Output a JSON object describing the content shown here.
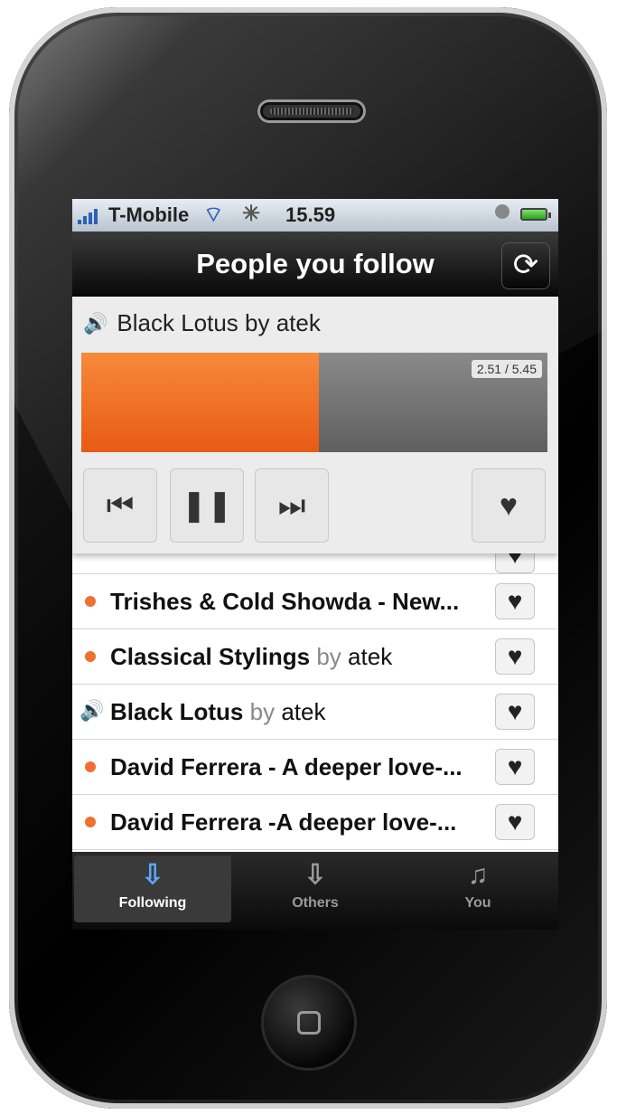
{
  "status_bar": {
    "carrier": "T-Mobile",
    "time": "15.59"
  },
  "nav": {
    "title": "People you follow",
    "refresh_icon": "refresh-icon"
  },
  "player": {
    "now_playing": "Black Lotus by atek",
    "elapsed": "2.51",
    "total": "5.45",
    "time_label": "2.51 / 5.45",
    "progress": 0.51,
    "colors": {
      "played": "#f07030",
      "unplayed": "#6f6f6f"
    },
    "controls": {
      "prev": "⏮",
      "pause": "❚❚",
      "next": "⏭",
      "favorite": "♥"
    }
  },
  "tracks": [
    {
      "title": "Trishes & Cold Showda - New...",
      "by": "",
      "artist": "",
      "playing": false
    },
    {
      "title": "Classical Stylings",
      "by": "by",
      "artist": "atek",
      "playing": false
    },
    {
      "title": "Black Lotus",
      "by": "by",
      "artist": "atek",
      "playing": true
    },
    {
      "title": "David Ferrera - A deeper love-...",
      "by": "",
      "artist": "",
      "playing": false
    },
    {
      "title": "David Ferrera -A deeper love-...",
      "by": "",
      "artist": "",
      "playing": false
    }
  ],
  "tabs": [
    {
      "label": "Following",
      "icon": "down-arrow-icon",
      "active": true
    },
    {
      "label": "Others",
      "icon": "down-arrow-icon",
      "active": false
    },
    {
      "label": "You",
      "icon": "music-note-icon",
      "active": false
    }
  ]
}
